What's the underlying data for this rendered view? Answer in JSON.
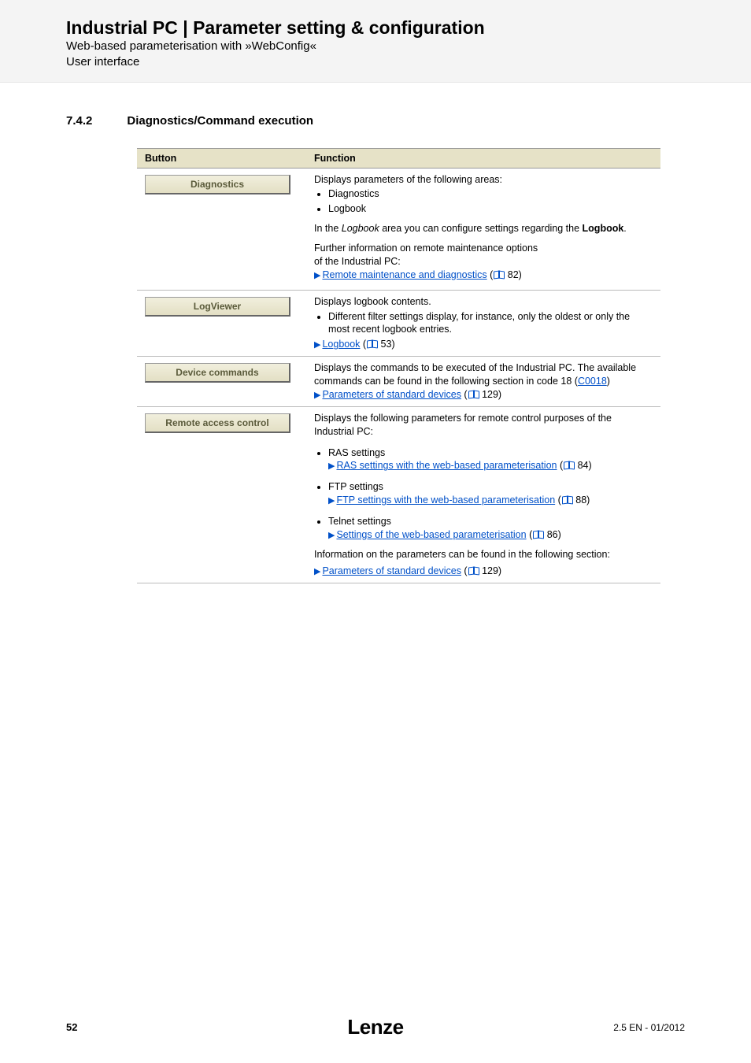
{
  "header": {
    "title": "Industrial PC | Parameter setting & configuration",
    "line1": "Web-based parameterisation with »WebConfig«",
    "line2": "User interface"
  },
  "section": {
    "number": "7.4.2",
    "title": "Diagnostics/Command execution"
  },
  "table": {
    "col_button": "Button",
    "col_function": "Function",
    "rows": [
      {
        "button": "Diagnostics",
        "fn": {
          "intro": "Displays parameters of the following areas:",
          "bullets": [
            "Diagnostics",
            "Logbook"
          ],
          "logbook_sentence_pre": "In the ",
          "logbook_word": "Logbook",
          "logbook_sentence_mid": " area you can configure settings regarding the ",
          "logbook_bold": "Logbook",
          "logbook_sentence_end": ".",
          "further1": "Further information on remote maintenance options",
          "further2": "of the Industrial PC:",
          "link_text": "Remote maintenance and diagnostics",
          "link_page": " 82)"
        }
      },
      {
        "button": "LogViewer",
        "fn": {
          "intro": "Displays logbook contents.",
          "bullet": "Different filter settings display, for instance, only the oldest or only the most recent logbook entries.",
          "link_text": "Logbook",
          "link_page": " 53)"
        }
      },
      {
        "button": "Device commands",
        "fn": {
          "text_pre": "Displays the commands to be executed of the Industrial PC. The available commands can be found in the following section in code 18 (",
          "code_link": "C0018",
          "text_post": ")",
          "link_text": "Parameters of standard devices",
          "link_page": " 129)"
        }
      },
      {
        "button": "Remote access control",
        "fn": {
          "intro": "Displays the following parameters for remote control purposes of the Industrial PC:",
          "ras_label": "RAS settings",
          "ras_link": "RAS settings with the web-based parameterisation",
          "ras_page": " 84)",
          "ftp_label": "FTP settings",
          "ftp_link": "FTP settings with the web-based parameterisation",
          "ftp_page": " 88)",
          "telnet_label": "Telnet settings",
          "telnet_link": "Settings of the web-based parameterisation",
          "telnet_page": " 86)",
          "info_line": "Information on the parameters can be found in the following section:",
          "param_link": "Parameters of standard devices",
          "param_page": " 129)"
        }
      }
    ]
  },
  "footer": {
    "page": "52",
    "brand": "Lenze",
    "meta": "2.5 EN - 01/2012"
  }
}
